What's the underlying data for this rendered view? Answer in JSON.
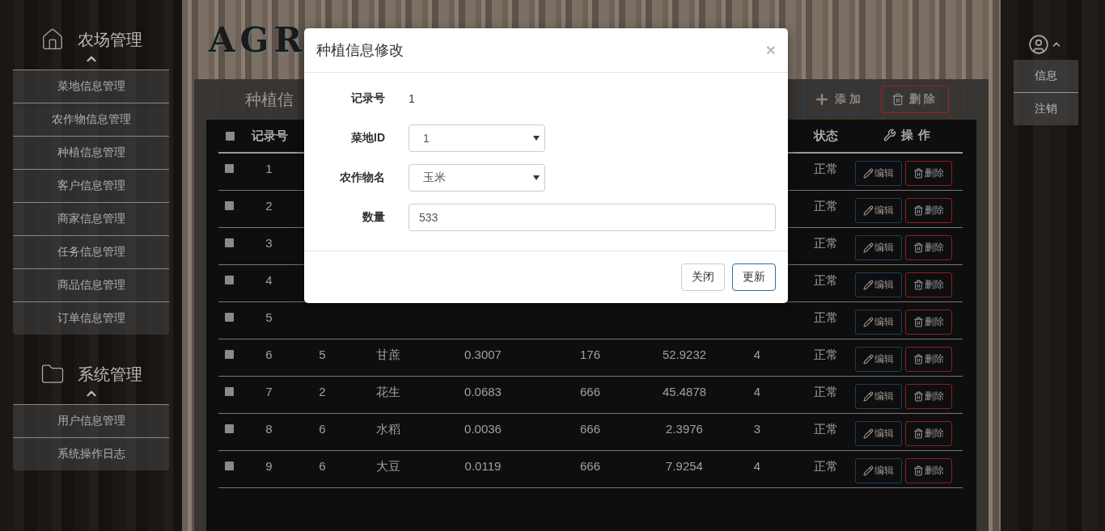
{
  "sidebar": {
    "sections": [
      {
        "kind": "home",
        "title": "农场管理",
        "expanded": true,
        "items": [
          "菜地信息管理",
          "农作物信息管理",
          "种植信息管理",
          "客户信息管理",
          "商家信息管理",
          "任务信息管理",
          "商品信息管理",
          "订单信息管理"
        ]
      },
      {
        "kind": "folder",
        "title": "系统管理",
        "expanded": true,
        "items": [
          "用户信息管理",
          "系统操作日志"
        ]
      }
    ]
  },
  "logo": {
    "text": "AGR"
  },
  "panel": {
    "title": "种植信",
    "toolbar": [
      {
        "kind": "add",
        "label": "添加"
      },
      {
        "kind": "delete",
        "label": "删除"
      }
    ]
  },
  "table": {
    "all_checked": false,
    "columns": {
      "column_1": "记录号",
      "status": "状态",
      "actions": "操作"
    },
    "rows": [
      {
        "checked": false,
        "column_1": "1",
        "status": "正常",
        "actions": [
          "编辑",
          "删除"
        ]
      },
      {
        "checked": false,
        "column_1": "2",
        "status": "正常",
        "actions": [
          "编辑",
          "删除"
        ]
      },
      {
        "checked": false,
        "column_1": "3",
        "status": "正常",
        "actions": [
          "编辑",
          "删除"
        ]
      },
      {
        "checked": false,
        "column_1": "4",
        "status": "正常",
        "actions": [
          "编辑",
          "删除"
        ]
      },
      {
        "checked": false,
        "column_1": "5",
        "status": "正常",
        "actions": [
          "编辑",
          "删除"
        ]
      },
      {
        "checked": false,
        "column_1": "6",
        "column_2": "5",
        "column_3": "甘蔗",
        "column_4": "0.3007",
        "column_5": "176",
        "column_6": "52.9232",
        "column_7": "4",
        "status": "正常",
        "actions": [
          "编辑",
          "删除"
        ]
      },
      {
        "checked": false,
        "column_1": "7",
        "column_2": "2",
        "column_3": "花生",
        "column_4": "0.0683",
        "column_5": "666",
        "column_6": "45.4878",
        "column_7": "4",
        "status": "正常",
        "actions": [
          "编辑",
          "删除"
        ]
      },
      {
        "checked": false,
        "column_1": "8",
        "column_2": "6",
        "column_3": "水稻",
        "column_4": "0.0036",
        "column_5": "666",
        "column_6": "2.3976",
        "column_7": "3",
        "status": "正常",
        "actions": [
          "编辑",
          "删除"
        ]
      },
      {
        "checked": false,
        "column_1": "9",
        "column_2": "6",
        "column_3": "大豆",
        "column_4": "0.0119",
        "column_5": "666",
        "column_6": "7.9254",
        "column_7": "4",
        "status": "正常",
        "actions": [
          "编辑",
          "删除"
        ]
      }
    ]
  },
  "user_menu": {
    "expanded": true,
    "items": [
      "信息",
      "注销"
    ]
  },
  "modal": {
    "title": "种植信息修改",
    "close": "×",
    "fields": [
      {
        "kind": "static",
        "label": "记录号",
        "value": "1"
      },
      {
        "kind": "select",
        "label": "菜地ID",
        "value": "1"
      },
      {
        "kind": "select",
        "label": "农作物名",
        "value": "玉米"
      },
      {
        "kind": "input",
        "label": "数量",
        "value": "533"
      }
    ],
    "buttons": [
      {
        "kind": "default",
        "label": "关闭"
      },
      {
        "kind": "primary",
        "label": "更新"
      }
    ]
  }
}
